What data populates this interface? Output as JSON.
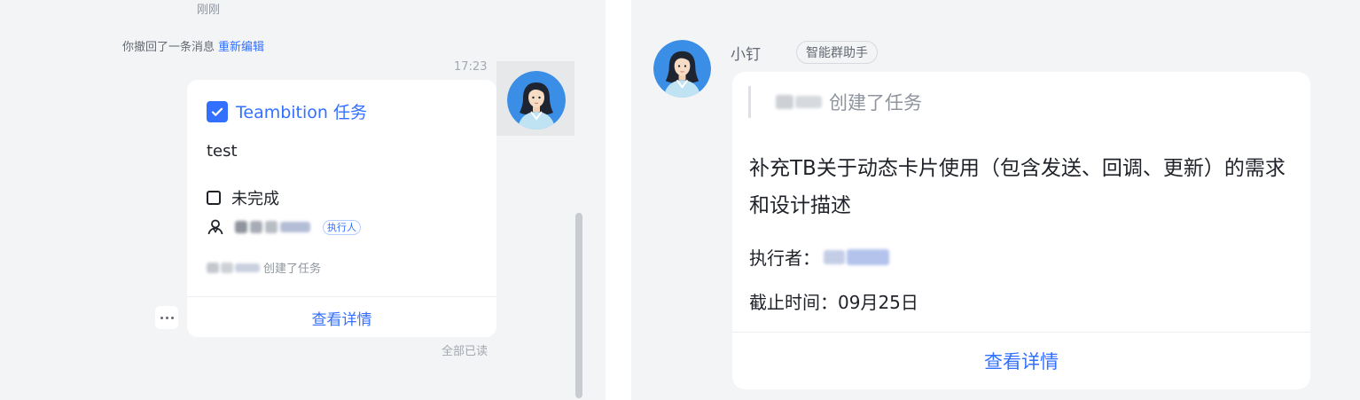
{
  "left": {
    "time_label": "刚刚",
    "recall": {
      "text": "你撤回了一条消息",
      "reedit_label": "重新编辑"
    },
    "message_time": "17:23",
    "card": {
      "app_title": "Teambition 任务",
      "task_name": "test",
      "status": "未完成",
      "assignee_tag": "执行人",
      "created_text": "创建了任务",
      "view_details": "查看详情"
    },
    "read_status": "全部已读"
  },
  "right": {
    "sender": "小钉",
    "bot_tag": "智能群助手",
    "card": {
      "quote_text": "创建了任务",
      "task_title": "补充TB关于动态卡片使用（包含发送、回调、更新）的需求和设计描述",
      "executor_label": "执行者：",
      "due_label": "截止时间：",
      "due_value": "09月25日",
      "view_details": "查看详情"
    }
  },
  "colors": {
    "accent": "#3370ff",
    "panel_bg": "#f3f4f6",
    "card_bg": "#ffffff",
    "text_primary": "#1f2329",
    "text_secondary": "#8f959e"
  }
}
